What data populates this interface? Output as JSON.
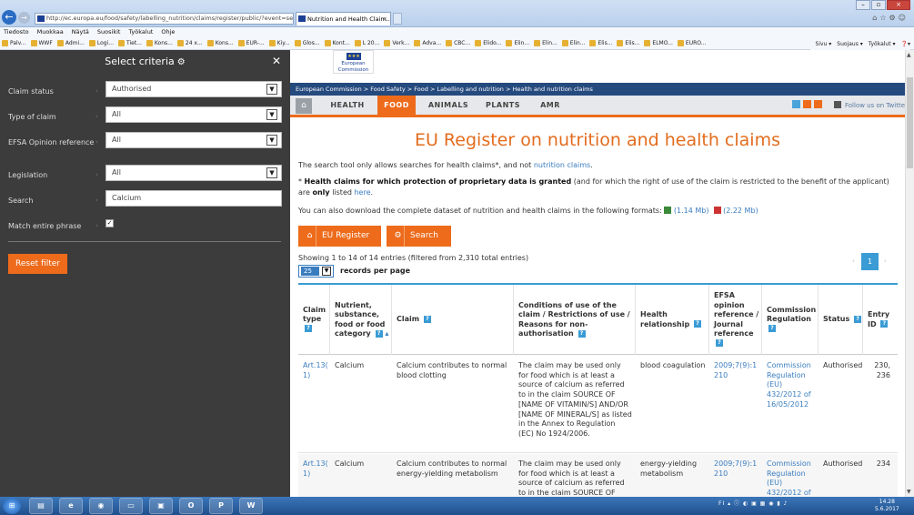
{
  "browser": {
    "address": "http://ec.europa.eu/food/safety/labelling_nutrition/claims/register/public/?event=searc",
    "tab_title": "Nutrition and Health Claim...",
    "menu": [
      "Tiedosto",
      "Muokkaa",
      "Näytä",
      "Suosikit",
      "Työkalut",
      "Ohje"
    ],
    "favorites": [
      "Palv...",
      "WWF",
      "Admi...",
      "Logi...",
      "Tiet...",
      "Kons...",
      "24 x...",
      "Kons...",
      "EUR-...",
      "Kiy...",
      "Glos...",
      "Kont...",
      "L 20...",
      "Verk...",
      "Adva...",
      "CBC...",
      "Elido...",
      "Elin...",
      "Elin...",
      "Elin...",
      "Elis...",
      "Elis...",
      "ELMO...",
      "EURO..."
    ],
    "fav_right": [
      "Sivu ▾",
      "Suojaus ▾",
      "Työkalut ▾",
      "❓▾"
    ]
  },
  "panel": {
    "title": "Select criteria",
    "criteria": [
      {
        "label": "Claim status",
        "value": "Authorised"
      },
      {
        "label": "Type of claim",
        "value": "All"
      },
      {
        "label": "EFSA Opinion reference",
        "value": "All"
      },
      {
        "label": "Legislation",
        "value": "All"
      }
    ],
    "search_label": "Search",
    "search_value": "Calcium",
    "match_label": "Match entire phrase",
    "match_checked": "✓",
    "reset_label": "Reset filter"
  },
  "site": {
    "logo_text": "European Commission",
    "breadcrumb": "European Commission > Food Safety > Food > Labelling and nutrition > Health and nutrition claims",
    "nav": [
      "HEALTH",
      "FOOD",
      "ANIMALS",
      "PLANTS",
      "AMR"
    ],
    "follow": "Follow us on Twitter"
  },
  "main": {
    "title": "EU Register on nutrition and health claims",
    "intro_a": "The search tool only allows searches for health claims*, and not",
    "intro_link": "nutrition claims",
    "intro_b": ".",
    "note_star": "*",
    "note_bold": "Health claims for which protection of proprietary data is granted",
    "note_mid": "(and for which the right of use of the claim is restricted to the benefit of the applicant) are",
    "note_bold2": "only",
    "note_end": "listed",
    "note_link": "here",
    "download_text": "You can also download the complete dataset of nutrition and health claims in the following formats:",
    "xls_size": "(1.14 Mb)",
    "pdf_size": "(2.22 Mb)",
    "btn_register": "EU Register",
    "btn_search": "Search",
    "showing": "Showing 1 to 14 of 14 entries (filtered from 2,310 total entries)",
    "rpp_value": "25",
    "rpp_label": "records per page",
    "page": "1"
  },
  "table": {
    "headers": {
      "claim_type": "Claim type",
      "nutrient": "Nutrient, substance, food or food category",
      "claim": "Claim",
      "conditions": "Conditions of use of the claim / Restrictions of use / Reasons for non-authorisation",
      "health": "Health relationship",
      "efsa": "EFSA opinion reference / Journal reference",
      "regulation": "Commission Regulation",
      "status": "Status",
      "entry": "Entry ID"
    },
    "rows": [
      {
        "claim_type": "Art.13(1)",
        "nutrient": "Calcium",
        "claim": "Calcium contributes to normal blood clotting",
        "conditions": "The claim may be used only for food which is at least a source of calcium as referred to in the claim SOURCE OF [NAME OF VITAMIN/S] AND/OR [NAME OF MINERAL/S] as listed in the Annex to Regulation (EC) No 1924/2006.",
        "health": "blood coagulation",
        "efsa": "2009;7(9):1210",
        "regulation": "Commission Regulation (EU) 432/2012 of 16/05/2012",
        "status": "Authorised",
        "entry": "230, 236"
      },
      {
        "claim_type": "Art.13(1)",
        "nutrient": "Calcium",
        "claim": "Calcium contributes to normal energy-yielding metabolism",
        "conditions": "The claim may be used only for food which is at least a source of calcium as referred to in the claim SOURCE OF [NAME OF",
        "health": "energy-yielding metabolism",
        "efsa": "2009;7(9):1210",
        "regulation": "Commission Regulation (EU) 432/2012 of",
        "status": "Authorised",
        "entry": "234"
      }
    ]
  },
  "taskbar": {
    "time": "14.28",
    "date": "5.6.2017",
    "tray": "FI ▴ ⓘ ◐ ▣ ▦ ◉ ▮ ♪"
  }
}
